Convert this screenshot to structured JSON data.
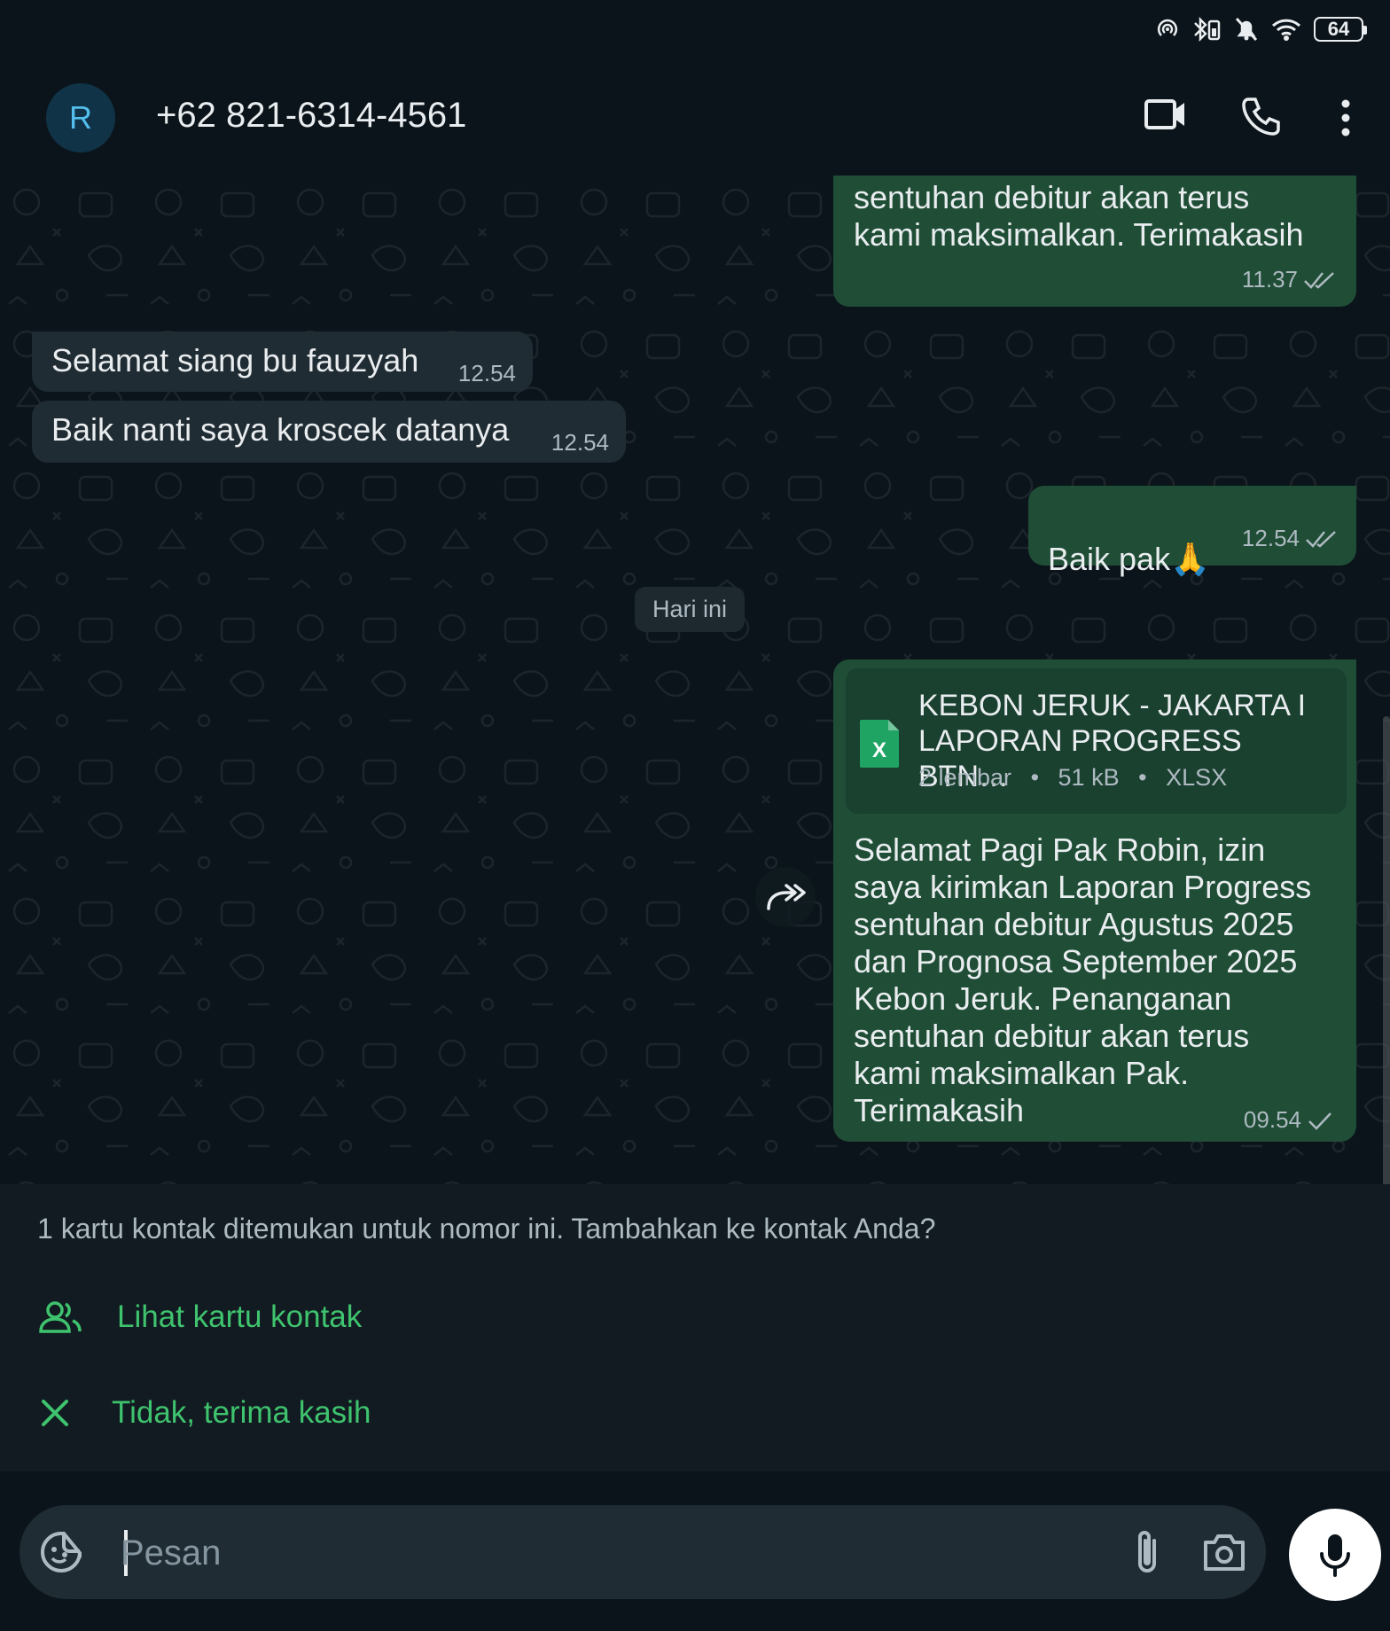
{
  "status_bar": {
    "battery": "64"
  },
  "header": {
    "avatar_initial": "R",
    "contact_name": "+62 821-6314-4561"
  },
  "messages": [
    {
      "dir": "out",
      "text": "sentuhan debitur akan terus\nkami maksimalkan. Terimakasih",
      "time": "11.37",
      "ticks": "double"
    },
    {
      "dir": "in",
      "text": "Selamat siang bu fauzyah",
      "time": "12.54"
    },
    {
      "dir": "in",
      "text": "Baik nanti saya kroscek datanya",
      "time": "12.54"
    },
    {
      "dir": "out",
      "text": "Baik pak",
      "emoji": "🙏",
      "time": "12.54",
      "ticks": "double"
    },
    {
      "dir": "out",
      "text": "Selamat Pagi Pak Robin, izin\nsaya kirimkan Laporan Progress\nsentuhan debitur Agustus 2025\ndan Prognosa September 2025\nKebon Jeruk. Penanganan\nsentuhan debitur akan terus\nkami maksimalkan Pak.\nTerimakasih",
      "time": "09.54",
      "ticks": "single"
    }
  ],
  "date_chip": "Hari ini",
  "document": {
    "title_line1": "KEBON JERUK - JAKARTA I",
    "title_line2": "LAPORAN PROGRESS BTN…",
    "pages": "2 lembar",
    "size": "51 kB",
    "type": "XLSX",
    "icon_letter": "X"
  },
  "banner": {
    "text": "1 kartu kontak ditemukan untuk nomor ini. Tambahkan ke kontak Anda?",
    "view_label": "Lihat kartu kontak",
    "dismiss_label": "Tidak, terima kasih"
  },
  "composer": {
    "placeholder": "Pesan"
  },
  "colors": {
    "outgoing_bubble": "#1f4d36",
    "incoming_bubble": "#202c33",
    "accent_green": "#3fc36e",
    "background": "#0b141a"
  }
}
